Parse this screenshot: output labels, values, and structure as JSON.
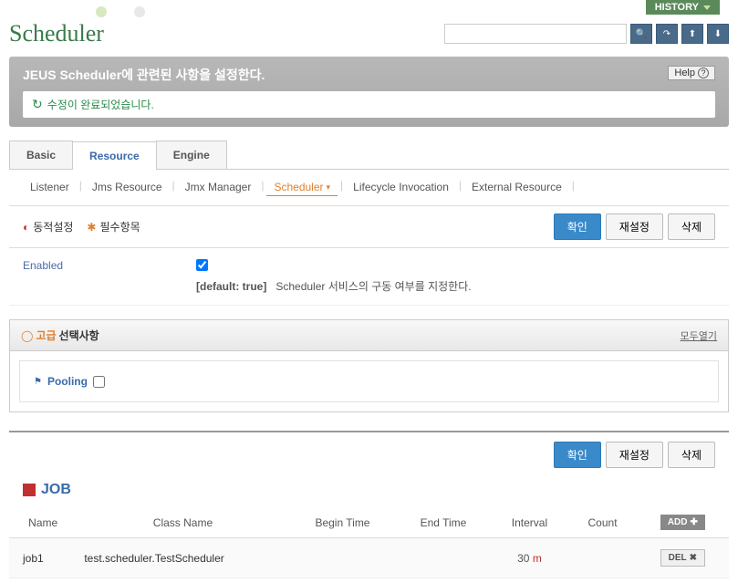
{
  "topbar": {
    "history_label": "HISTORY"
  },
  "header": {
    "title": "Scheduler",
    "search_placeholder": ""
  },
  "description": {
    "text": "JEUS Scheduler에 관련된 사항을 설정한다.",
    "help_label": "Help",
    "success_msg": "수정이 완료되었습니다."
  },
  "tabs": {
    "items": [
      "Basic",
      "Resource",
      "Engine"
    ],
    "active_index": 1
  },
  "subtabs": {
    "items": [
      "Listener",
      "Jms Resource",
      "Jmx Manager",
      "Scheduler",
      "Lifecycle Invocation",
      "External Resource"
    ],
    "active_index": 3
  },
  "legend": {
    "dynamic": "동적설정",
    "required": "필수항목"
  },
  "buttons": {
    "confirm": "확인",
    "reset": "재설정",
    "delete": "삭제",
    "add": "ADD",
    "del": "DEL"
  },
  "form": {
    "enabled_label": "Enabled",
    "enabled_checked": true,
    "enabled_default_label": "[default: true]",
    "enabled_desc": "Scheduler 서비스의 구동 여부를 지정한다."
  },
  "advanced": {
    "title_orange": "고급",
    "title_black": "선택사항",
    "expand_all": "모두열기",
    "pooling_label": "Pooling"
  },
  "job": {
    "title": "JOB",
    "columns": [
      "Name",
      "Class Name",
      "Begin Time",
      "End Time",
      "Interval",
      "Count",
      ""
    ],
    "rows": [
      {
        "name": "job1",
        "class_name": "test.scheduler.TestScheduler",
        "begin_time": "",
        "end_time": "",
        "interval_val": "30",
        "interval_unit": "m",
        "count": ""
      }
    ]
  }
}
